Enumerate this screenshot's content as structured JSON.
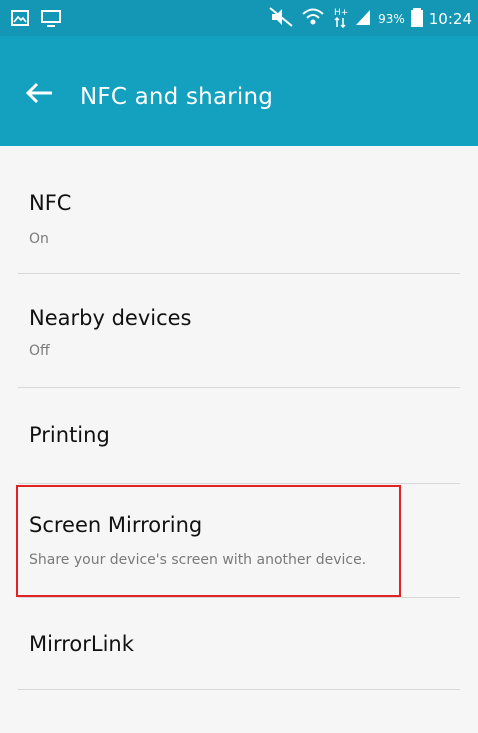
{
  "status_bar": {
    "battery_percent": "93%",
    "time": "10:24",
    "network_type": "H+",
    "icons": [
      "gallery-icon",
      "cast-icon",
      "mute-icon",
      "wifi-icon",
      "data-arrows-icon",
      "signal-icon",
      "battery-icon"
    ]
  },
  "header": {
    "title": "NFC and sharing",
    "back_icon": "back-arrow-icon"
  },
  "items": [
    {
      "title": "NFC",
      "subtitle": "On"
    },
    {
      "title": "Nearby devices",
      "subtitle": "Off"
    },
    {
      "title": "Printing"
    },
    {
      "title": "Screen Mirroring",
      "subtitle": "Share your device's screen with another device."
    },
    {
      "title": "MirrorLink"
    }
  ],
  "colors": {
    "status_bar": "#1397b4",
    "app_bar": "#13a1bf",
    "highlight_border": "#e02424"
  }
}
